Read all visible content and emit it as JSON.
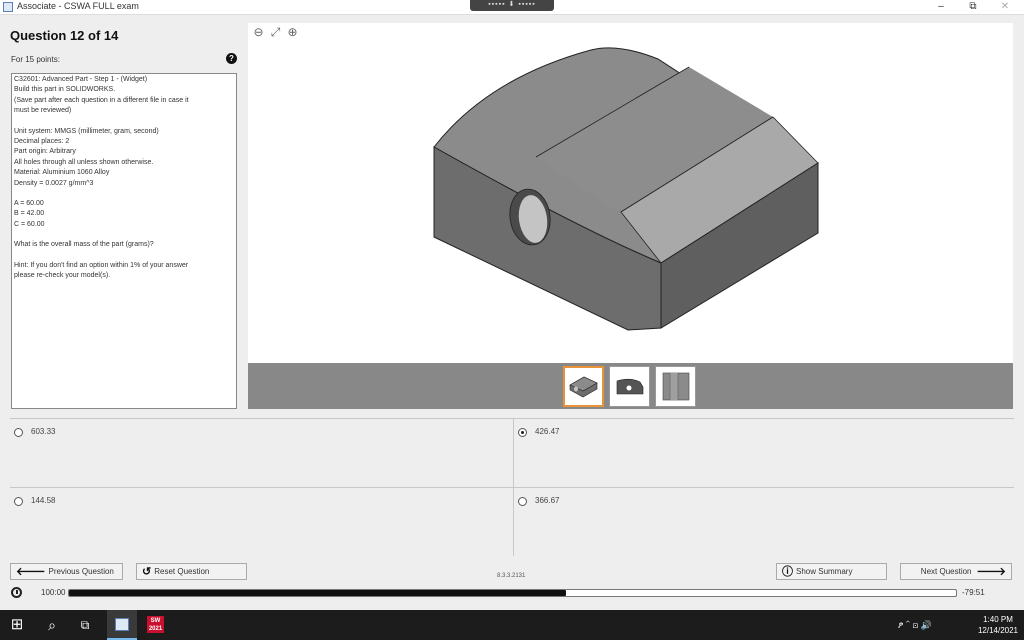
{
  "window": {
    "title": "Associate - CSWA FULL exam",
    "minimize_glyph": "–",
    "restore_glyph": "⧉",
    "close_glyph": "✕",
    "drag_handle_glyph": "▪▪▪▪▪ ⬇ ▪▪▪▪▪"
  },
  "question": {
    "title": "Question 12 of 14",
    "points": "For 15 points:",
    "help_icon": "question-circle-icon",
    "help_glyph": "?",
    "text": {
      "line1": "C32601: Advanced Part - Step 1 - (Widget)",
      "line2": "Build this part in SOLIDWORKS.",
      "line3": "(Save part after each question in a different file in case it",
      "line4": "must be reviewed)",
      "line5": "Unit system: MMGS (millimeter, gram, second)",
      "line6": "Decimal places: 2",
      "line7": "Part origin: Arbitrary",
      "line8": "All holes through all unless shown otherwise.",
      "line9": "Material: Aluminium 1060 Alloy",
      "line10": "Density = 0.0027 g/mm^3",
      "line11": "A = 60.00",
      "line12": "B = 42.00",
      "line13": "C = 60.00",
      "line14": "What is the overall mass of the part (grams)?",
      "line15": "Hint: If you don't find an option within 1% of your answer",
      "line16": "please re-check your model(s)."
    }
  },
  "viewer": {
    "zoom_out_glyph": "⊖",
    "fit_glyph": "⤢",
    "zoom_in_glyph": "⊕",
    "thumbnails": [
      "isometric-view",
      "front-view",
      "top-view"
    ],
    "active_thumbnail": 0,
    "colors": {
      "face_top": "#8a8a8a",
      "face_front": "#6c6c6c",
      "face_side": "#5f5f5f",
      "face_light": "#a9a9a9",
      "edge": "#222222",
      "accent": "#e8923a"
    }
  },
  "answers": [
    {
      "value": "603.33",
      "selected": false
    },
    {
      "value": "426.47",
      "selected": true
    },
    {
      "value": "144.58",
      "selected": false
    },
    {
      "value": "366.67",
      "selected": false
    }
  ],
  "buttons": {
    "previous": "Previous Question",
    "previous_icon": "arrow-left-icon",
    "previous_glyph": "🡐",
    "reset": "Reset Question",
    "reset_icon": "reset-icon",
    "reset_glyph": "↺",
    "summary": "Show Summary",
    "summary_icon": "info-icon",
    "summary_glyph": "ⓘ",
    "next": "Next Question",
    "next_icon": "arrow-right-icon",
    "next_glyph": "🡒"
  },
  "version": "8.3.3.2131",
  "timer": {
    "total": "100:00",
    "remaining": "-79:51",
    "elapsed_fraction": 0.56
  },
  "taskbar": {
    "start_glyph": "⊞",
    "search_glyph": "⌕",
    "taskview_glyph": "⧉",
    "app1": "exam-app-icon",
    "app2": "solidworks-icon",
    "app2_label": "SW 2021",
    "tray_glyphs": "ፆ  ⌃  ⊡  🔊",
    "time": "1:40 PM",
    "date": "12/14/2021"
  }
}
